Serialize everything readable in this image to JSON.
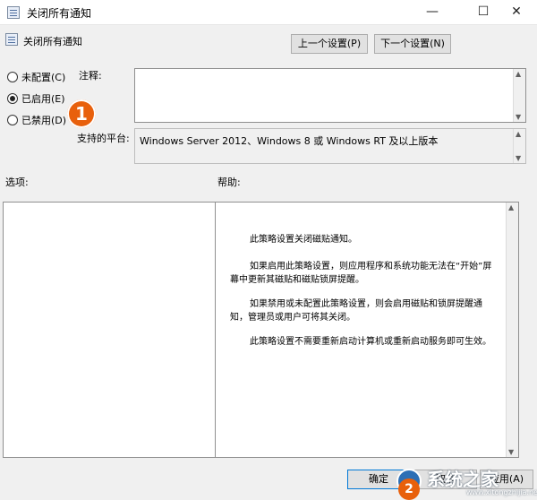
{
  "window": {
    "title": "关闭所有通知",
    "minimize_glyph": "—",
    "maximize_glyph": "☐",
    "close_glyph": "✕"
  },
  "header": {
    "setting_name": "关闭所有通知",
    "prev_button": "上一个设置(P)",
    "next_button": "下一个设置(N)"
  },
  "state_options": [
    {
      "label": "未配置(C)",
      "selected": false
    },
    {
      "label": "已启用(E)",
      "selected": true
    },
    {
      "label": "已禁用(D)",
      "selected": false
    }
  ],
  "annotations": {
    "marker_1": "1",
    "marker_2": "2"
  },
  "labels": {
    "comment": "注释:",
    "supported_platform": "支持的平台:",
    "options": "选项:",
    "help": "帮助:"
  },
  "comment_value": "",
  "supported_platform_value": "Windows Server 2012、Windows 8 或 Windows RT 及以上版本",
  "help_text": [
    "此策略设置关闭磁贴通知。",
    "如果启用此策略设置，则应用程序和系统功能无法在“开始”屏幕中更新其磁贴和磁贴锁屏提醒。",
    "如果禁用或未配置此策略设置，则会启用磁贴和锁屏提醒通知，管理员或用户可将其关闭。",
    "此策略设置不需要重新启动计算机或重新启动服务即可生效。"
  ],
  "footer": {
    "ok_button": "确定",
    "cancel_button": "取消",
    "apply_button": "应用(A)"
  },
  "watermark": {
    "text": "系统之家",
    "url": "www.xitongzhijia.net"
  },
  "colors": {
    "marker": "#e8600c",
    "accent": "#0078d7"
  }
}
